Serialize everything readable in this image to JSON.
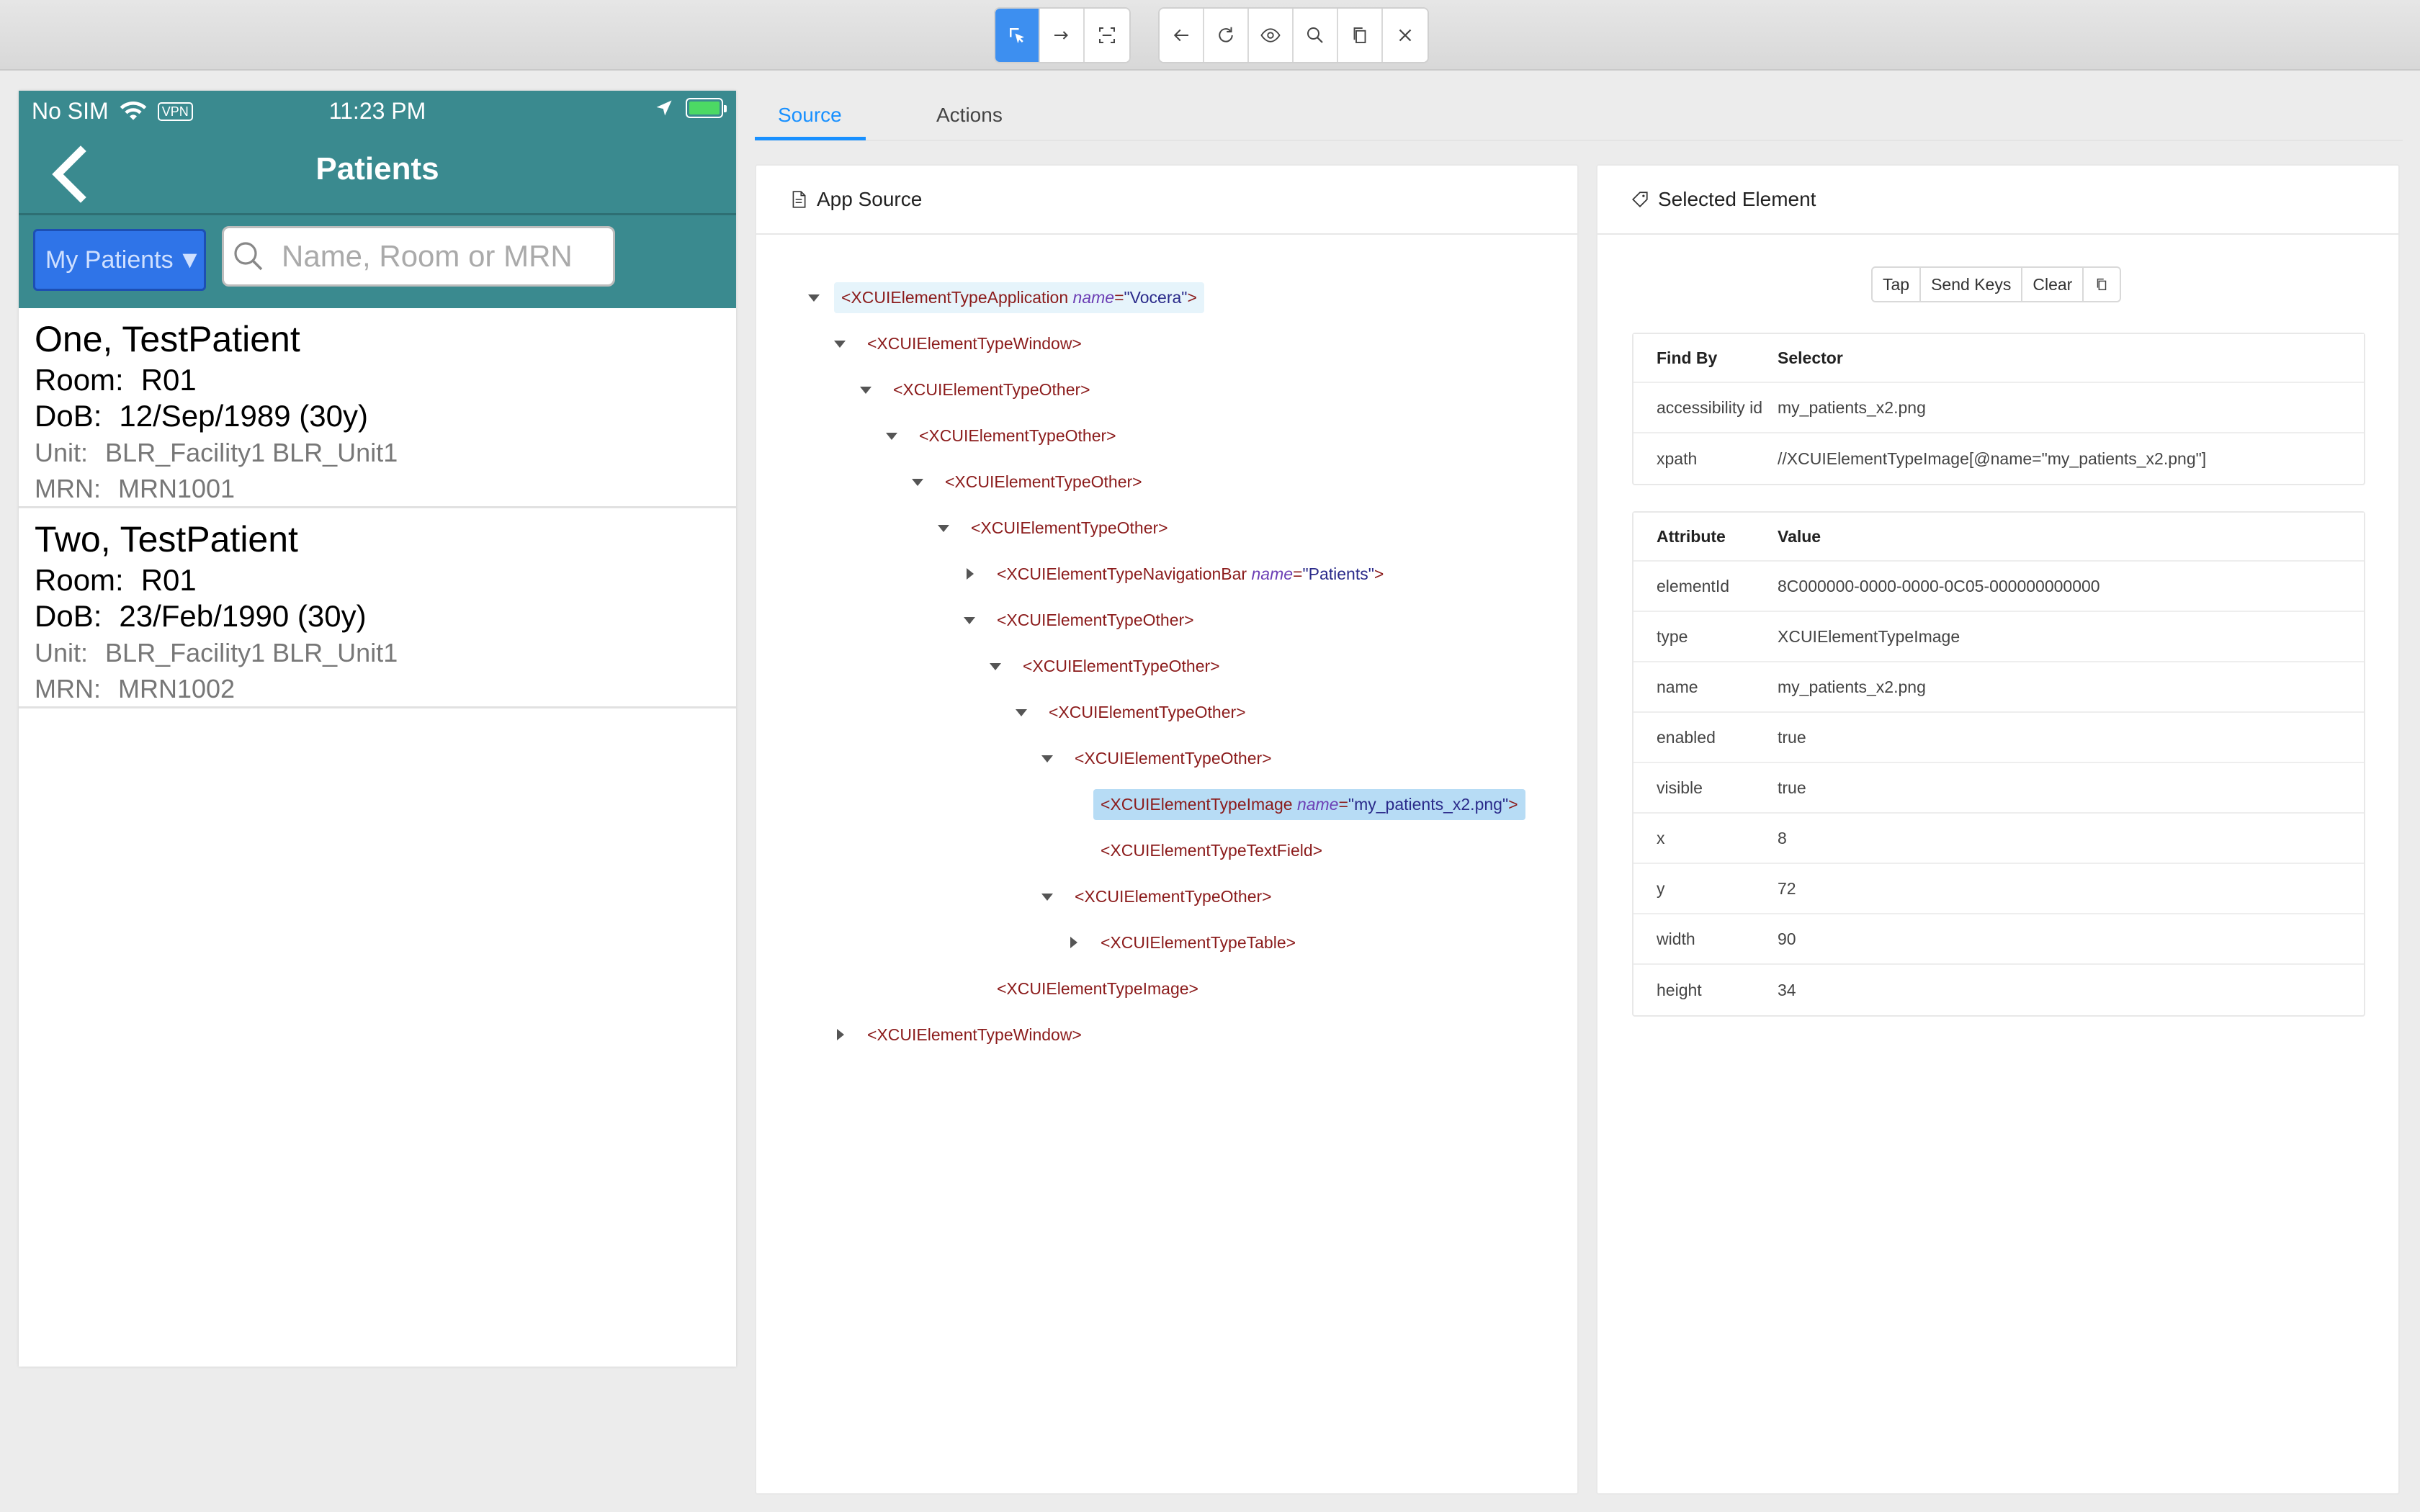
{
  "toolbar": {
    "buttons": [
      "select-element-icon",
      "swipe-icon",
      "screenshot-region-icon",
      "back-icon",
      "refresh-icon",
      "show-icon",
      "search-icon",
      "copy-icon",
      "close-icon"
    ]
  },
  "device": {
    "status": {
      "carrier": "No SIM",
      "vpn": "VPN",
      "time": "11:23 PM"
    },
    "nav_title": "Patients",
    "filter_label": "My Patients",
    "filter_arrow": "▼",
    "search_placeholder": "Name, Room or MRN",
    "patients": [
      {
        "name": "One, TestPatient",
        "room_label": "Room:",
        "room": "R01",
        "dob_label": "DoB:",
        "dob": "12/Sep/1989 (30y)",
        "unit_label": "Unit:",
        "unit": "BLR_Facility1 BLR_Unit1",
        "mrn_label": "MRN:",
        "mrn": "MRN1001"
      },
      {
        "name": "Two, TestPatient",
        "room_label": "Room:",
        "room": "R01",
        "dob_label": "DoB:",
        "dob": "23/Feb/1990 (30y)",
        "unit_label": "Unit:",
        "unit": "BLR_Facility1 BLR_Unit1",
        "mrn_label": "MRN:",
        "mrn": "MRN1002"
      }
    ]
  },
  "tabs": {
    "source": "Source",
    "actions": "Actions"
  },
  "app_source": {
    "title": "App Source",
    "nodes": [
      {
        "text": "<XCUIElementTypeApplication ",
        "attr": "name",
        "val": "\"Vocera\"",
        "end": ">"
      },
      {
        "text": "<XCUIElementTypeWindow>"
      },
      {
        "text": "<XCUIElementTypeOther>"
      },
      {
        "text": "<XCUIElementTypeOther>"
      },
      {
        "text": "<XCUIElementTypeOther>"
      },
      {
        "text": "<XCUIElementTypeOther>"
      },
      {
        "text": "<XCUIElementTypeNavigationBar ",
        "attr": "name",
        "val": "\"Patients\"",
        "end": ">"
      },
      {
        "text": "<XCUIElementTypeOther>"
      },
      {
        "text": "<XCUIElementTypeOther>"
      },
      {
        "text": "<XCUIElementTypeOther>"
      },
      {
        "text": "<XCUIElementTypeOther>"
      },
      {
        "text": "<XCUIElementTypeImage ",
        "attr": "name",
        "val": "\"my_patients_x2.png\"",
        "end": ">"
      },
      {
        "text": "<XCUIElementTypeTextField>"
      },
      {
        "text": "<XCUIElementTypeOther>"
      },
      {
        "text": "<XCUIElementTypeTable>"
      },
      {
        "text": "<XCUIElementTypeImage>"
      },
      {
        "text": "<XCUIElementTypeWindow>"
      }
    ]
  },
  "selected": {
    "title": "Selected Element",
    "actions": {
      "tap": "Tap",
      "send_keys": "Send Keys",
      "clear": "Clear"
    },
    "find_by": {
      "headers": {
        "k": "Find By",
        "v": "Selector"
      },
      "rows": [
        {
          "k": "accessibility id",
          "v": "my_patients_x2.png"
        },
        {
          "k": "xpath",
          "v": "//XCUIElementTypeImage[@name=\"my_patients_x2.png\"]"
        }
      ]
    },
    "attributes": {
      "headers": {
        "k": "Attribute",
        "v": "Value"
      },
      "rows": [
        {
          "k": "elementId",
          "v": "8C000000-0000-0000-0C05-000000000000"
        },
        {
          "k": "type",
          "v": "XCUIElementTypeImage"
        },
        {
          "k": "name",
          "v": "my_patients_x2.png"
        },
        {
          "k": "enabled",
          "v": "true"
        },
        {
          "k": "visible",
          "v": "true"
        },
        {
          "k": "x",
          "v": "8"
        },
        {
          "k": "y",
          "v": "72"
        },
        {
          "k": "width",
          "v": "90"
        },
        {
          "k": "height",
          "v": "34"
        }
      ]
    }
  }
}
